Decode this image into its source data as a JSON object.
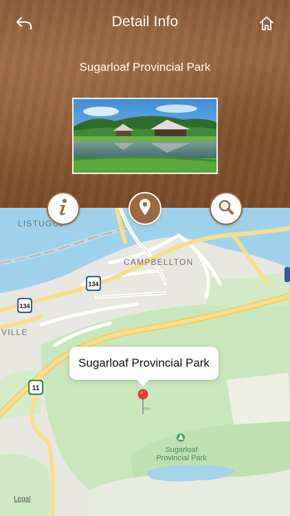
{
  "header": {
    "title": "Detail Info",
    "place_name": "Sugarloaf Provincial Park"
  },
  "actions": {
    "info_icon": "info-icon",
    "map_icon": "map-pin-icon",
    "search_icon": "search-icon"
  },
  "map": {
    "labels": {
      "listuguj": "LISTUGUJ",
      "campbellton": "CAMPBELLTON",
      "ville": "VILLE"
    },
    "park_label": "Sugarloaf Provincial Park",
    "callout_title": "Sugarloaf Provincial Park",
    "legal": "Legal",
    "route_shields": [
      "134",
      "134",
      "11"
    ]
  },
  "colors": {
    "brand": "#9d6840",
    "water": "#9fd2ea",
    "park_green": "#c6e6b8",
    "road": "#f7d77a",
    "pin": "#e53935"
  }
}
